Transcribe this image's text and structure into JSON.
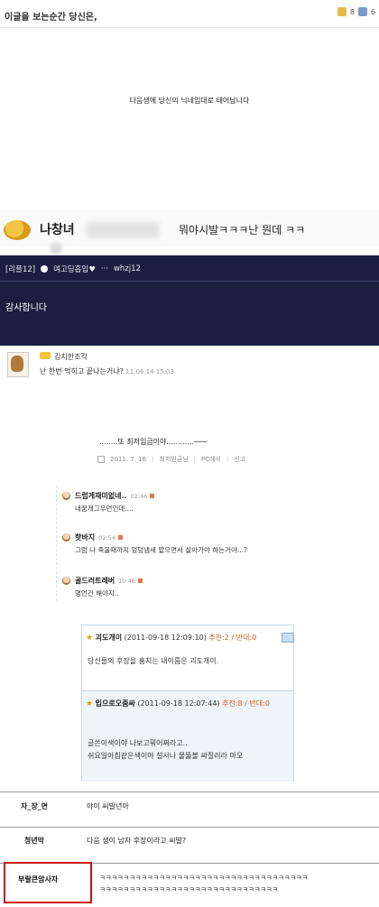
{
  "header": {
    "title": "이글을 보는순간 당신은,",
    "up_count": "8",
    "down_count": "6"
  },
  "center_message": "다음생에 당신의 닉네임대로 태어납니다",
  "chat": {
    "name": "나창녀",
    "message": "뭐야시발ㅋㅋㅋ난 뭔데 ㅋㅋ"
  },
  "dark_comment": {
    "reply_label": "[리플12]",
    "nickname": "여고딩흡입♥",
    "dots": "···",
    "user_id": "whzj12",
    "body": "감사합니다"
  },
  "comment1": {
    "nickname": "김치한조각",
    "text": "난 한번 먹히고 끝나는거냐?",
    "date": "11.06.14 15:03"
  },
  "post2": {
    "line": "........또 최저임금이야............───",
    "date": "2011. 7. 16",
    "author": "최저임금님",
    "pc": "PC에서",
    "report": "신고"
  },
  "replies": [
    {
      "nick": "드럽게재미없네..",
      "time": "02:46",
      "text": "내꿈개그우먼인데...."
    },
    {
      "nick": "핫바지",
      "time": "02:54",
      "text": "그럼 나 죽을때까지 엉덩냄새 맡으면서 살아가야 하는거야...?"
    },
    {
      "nick": "골드러트레버",
      "time": "10:46",
      "text": "명언건 해야지.."
    }
  ],
  "nested": {
    "first": {
      "nick": "괴도개이",
      "date": "(2011-09-18 12:09:10)",
      "votes": "추천:2 / 반대:0",
      "text": "당신들의 후장을 훔치는 내이름은 괴도개이."
    },
    "second": {
      "nick": "입으로오줌싸",
      "date": "(2011-09-18 12:07:44)",
      "votes": "추천:8 / 반대:0",
      "line1": "글쓴이색이야 나보고뭐어쩌라고..",
      "line2": "쉬요일아침같은색이야  설사나 물뚫볼 싸질러라 마오"
    }
  },
  "table": {
    "rows": [
      {
        "label": "자_장_면",
        "value": "야이 씨발년아"
      },
      {
        "label": "청년막",
        "value": "다음 생이 남자 후장이라고 씨발?"
      }
    ],
    "highlight_label": "부랄큰암사자",
    "kk_line1": "ㅋㅋㅋㅋㅋㅋㅋㅋㅋㅋㅋㅋㅋㅋㅋㅋㅋㅋㅋㅋㅋㅋㅋㅋㅋㅋㅋㅋㅋㅋㅋㅋㅋㅋㅋ",
    "kk_line2": "ㅋㅋㅋㅋㅋㅋㅋㅋㅋㅋㅋㅋㅋㅋㅋㅋㅋㅋㅋㅋㅋㅋㅋㅋㅋㅋㅋㅋㅋㅋ"
  },
  "colors": {
    "dark_bg": "#1a1f3f",
    "highlight_border": "#cc1111",
    "vote_accent": "#d65d1a"
  }
}
